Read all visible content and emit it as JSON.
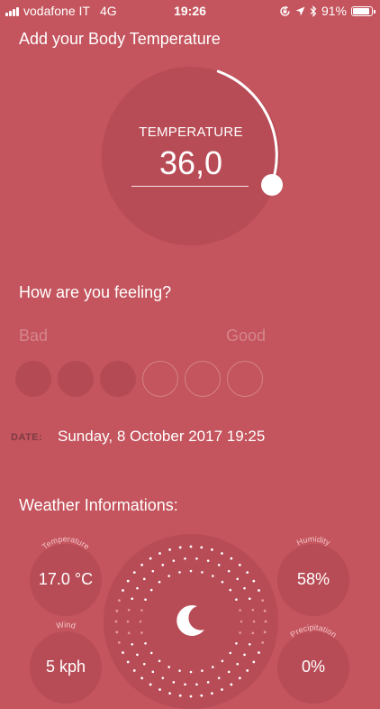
{
  "status_bar": {
    "carrier": "vodafone IT",
    "network": "4G",
    "time": "19:26",
    "battery": "91%",
    "battery_level": 0.91
  },
  "title": "Add your Body Temperature",
  "temperature": {
    "label": "TEMPERATURE",
    "value": "36,0"
  },
  "feeling": {
    "question": "How are you feeling?",
    "bad_label": "Bad",
    "good_label": "Good",
    "selected_count": 3,
    "total": 6
  },
  "date": {
    "label": "DATE:",
    "value": "Sunday, 8 October 2017 19:25"
  },
  "weather": {
    "heading": "Weather Informations:",
    "temperature": {
      "label": "Temperature",
      "value": "17.0 °C"
    },
    "humidity": {
      "label": "Humidity",
      "value": "58%"
    },
    "wind": {
      "label": "Wind",
      "value": "5 kph"
    },
    "precipitation": {
      "label": "Precipitation",
      "value": "0%"
    },
    "condition_icon": "moon-icon"
  },
  "colors": {
    "background": "#c4545d",
    "panel": "#b84c56",
    "muted_text": "#d6858c",
    "date_label": "#7e3b42"
  }
}
